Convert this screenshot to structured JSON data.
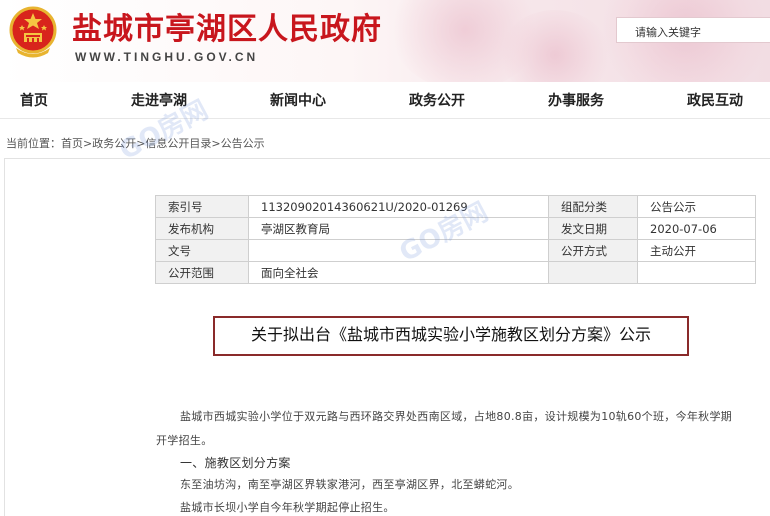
{
  "header": {
    "site_title": "盐城市亭湖区人民政府",
    "site_url": "WWW.TINGHU.GOV.CN",
    "search_placeholder": "请输入关键字"
  },
  "nav": {
    "items": [
      {
        "label": "首页"
      },
      {
        "label": "走进亭湖"
      },
      {
        "label": "新闻中心"
      },
      {
        "label": "政务公开"
      },
      {
        "label": "办事服务"
      },
      {
        "label": "政民互动"
      }
    ]
  },
  "breadcrumb": "当前位置：首页>政务公开>信息公开目录>公告公示",
  "meta": {
    "index_label": "索引号",
    "index_value": "11320902014360621U/2020-01269",
    "category_label": "组配分类",
    "category_value": "公告公示",
    "publisher_label": "发布机构",
    "publisher_value": "亭湖区教育局",
    "date_label": "发文日期",
    "date_value": "2020-07-06",
    "docno_label": "文号",
    "docno_value": "",
    "method_label": "公开方式",
    "method_value": "主动公开",
    "scope_label": "公开范围",
    "scope_value": "面向全社会"
  },
  "document": {
    "title": "关于拟出台《盐城市西城实验小学施教区划分方案》公示",
    "para1_line1": "盐城市西城实验小学位于双元路与西环路交界处西南区域，占地80.8亩，设计规模为10轨60个班，今年秋学期",
    "para1_line2": "开学招生。",
    "section1_heading": "一、施教区划分方案",
    "section1_line1": "东至油坊沟，南至亭湖区界轶家港河，西至亭湖区界，北至蟒蛇河。",
    "section1_line2": "盐城市长坝小学自今年秋学期起停止招生。"
  },
  "watermark": "GO房网"
}
